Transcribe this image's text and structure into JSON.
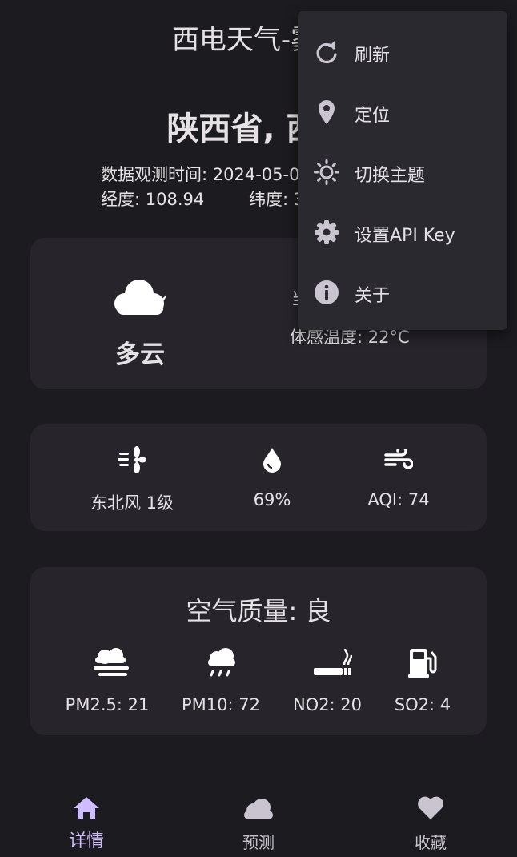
{
  "app": {
    "title": "西电天气-雾霾"
  },
  "header": {
    "location": "陕西省, 西安",
    "observe_time": "数据观测时间: 2024-05-0",
    "longitude": "经度: 108.94",
    "latitude": "纬度: 3"
  },
  "current": {
    "condition": "多云",
    "condition_icon": "cloud-moon-icon",
    "temp_partial": "当",
    "feels_like": "体感温度: 22°C"
  },
  "stats": [
    {
      "icon": "wind-fan-icon",
      "label": "东北风 1级"
    },
    {
      "icon": "droplet-icon",
      "label": "69%"
    },
    {
      "icon": "wind-icon",
      "label": "AQI: 74"
    }
  ],
  "air_quality": {
    "title": "空气质量: 良",
    "items": [
      {
        "icon": "smog-icon",
        "label": "PM2.5: 21"
      },
      {
        "icon": "cloud-rain-icon",
        "label": "PM10: 72"
      },
      {
        "icon": "smoking-icon",
        "label": "NO2: 20"
      },
      {
        "icon": "gas-pump-icon",
        "label": "SO2: 4"
      }
    ]
  },
  "menu": {
    "items": [
      {
        "icon": "refresh-icon",
        "label": "刷新"
      },
      {
        "icon": "location-pin-icon",
        "label": "定位"
      },
      {
        "icon": "sun-icon",
        "label": "切换主题"
      },
      {
        "icon": "gear-icon",
        "label": "设置API Key"
      },
      {
        "icon": "info-icon",
        "label": "关于"
      }
    ]
  },
  "bottom_nav": {
    "items": [
      {
        "icon": "home-icon",
        "label": "详情",
        "active": true
      },
      {
        "icon": "cloud-icon",
        "label": "预测"
      },
      {
        "icon": "heart-icon",
        "label": "收藏"
      }
    ]
  },
  "colors": {
    "background": "#1c1b1f",
    "card": "#27252b",
    "menu": "#2b2930",
    "text": "#e6e1e5",
    "accent": "#cfbcff"
  }
}
